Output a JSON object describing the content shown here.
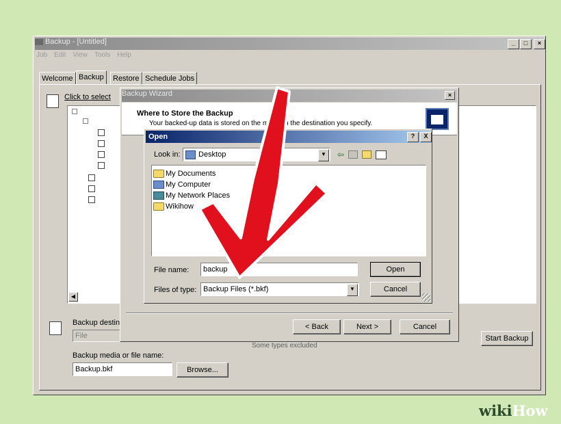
{
  "main_window": {
    "title": "Backup - [Untitled]",
    "menu": [
      "Job",
      "Edit",
      "View",
      "Tools",
      "Help"
    ],
    "tabs": [
      "Welcome",
      "Backup",
      "Restore",
      "Schedule Jobs"
    ],
    "select_label": "Click to select",
    "backup_destination_label": "Backup destina",
    "destination_value": "File",
    "media_label": "Backup media or file name:",
    "media_value": "Backup.bkf",
    "browse_button": "Browse...",
    "start_backup_button": "Start Backup",
    "summary_text": "Some types excluded"
  },
  "wizard": {
    "title": "Backup Wizard",
    "heading": "Where to Store the Backup",
    "subheading": "Your backed-up data is stored on the media in the destination you specify.",
    "back_button": "< Back",
    "next_button": "Next >",
    "cancel_button": "Cancel"
  },
  "open_dialog": {
    "title": "Open",
    "look_in_label": "Look in:",
    "look_in_value": "Desktop",
    "items": [
      "My Documents",
      "My Computer",
      "My Network Places",
      "Wikihow"
    ],
    "file_name_label": "File name:",
    "file_name_value": "backup",
    "files_of_type_label": "Files of type:",
    "files_of_type_value": "Backup Files (*.bkf)",
    "open_button": "Open",
    "cancel_button": "Cancel",
    "help_glyph": "?",
    "close_glyph": "X"
  },
  "watermark": {
    "wiki": "wiki",
    "how": "How"
  },
  "colors": {
    "background": "#d0e8b4",
    "window_face": "#d4d0c8",
    "active_title": "#0a246a",
    "arrow_red": "#e0101c"
  }
}
